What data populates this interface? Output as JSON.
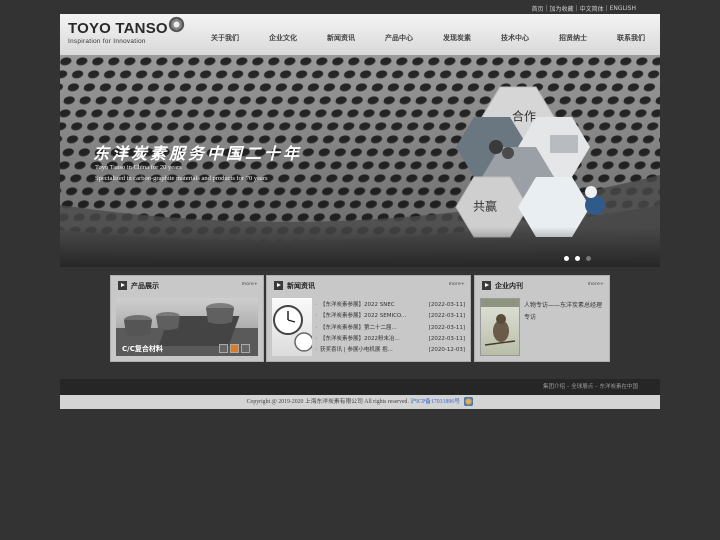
{
  "top_links": [
    "首页",
    "加为收藏",
    "中文简体",
    "ENGLISH"
  ],
  "logo": {
    "name": "TOYO TANSO",
    "tagline": "Inspiration for Innovation"
  },
  "nav": [
    "关于我们",
    "企业文化",
    "新闻资讯",
    "产品中心",
    "发现炭素",
    "技术中心",
    "招贤纳士",
    "联系我们"
  ],
  "banner": {
    "title": "东洋炭素服务中国二十年",
    "sub1": "Toyo Tanso in China for 20 years",
    "sub2": "Specialized in carbon-graphite materials and products for 70 years",
    "hex1": "合作",
    "hex2": "共赢",
    "active_slide": 1
  },
  "panels": {
    "products": {
      "title": "产品展示",
      "more": "more+",
      "caption": "C/C复合材料"
    },
    "news": {
      "title": "新闻资讯",
      "more": "more+",
      "items": [
        {
          "title": "【东洋炭素参展】2022 SNEC",
          "date": "[2022-03-11]"
        },
        {
          "title": "【东洋炭素参展】2022 SEMICO...",
          "date": "[2022-03-11]"
        },
        {
          "title": "【东洋炭素参展】第二十二届...",
          "date": "[2022-03-11]"
        },
        {
          "title": "【东洋炭素参展】2022粉末冶...",
          "date": "[2022-03-11]"
        },
        {
          "title": "获奖喜讯 | 参展小电机展 抱...",
          "date": "[2020-12-03]"
        }
      ]
    },
    "magazine": {
      "title": "企业内刊",
      "more": "more+",
      "text": "人物专访——东洋炭素总经理专访"
    }
  },
  "footer": {
    "links": "集团介绍 – 全球展点 – 东洋炭素在中国",
    "copyright": "Copyright @ 2019-2020 上海东洋炭素有限公司 All rights reserved.",
    "icp": "沪ICP备17031896号"
  }
}
